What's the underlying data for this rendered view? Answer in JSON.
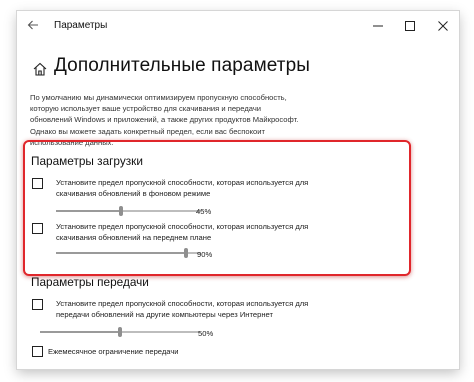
{
  "window": {
    "title": "Параметры"
  },
  "page": {
    "title": "Дополнительные параметры"
  },
  "description": "По умолчанию мы динамически оптимизируем пропускную способность, которую использует ваше устройство для скачивания и передачи обновлений Windows и приложений, а также других продуктов Майкрософт. Однако вы можете задать конкретный предел, если вас беспокоит использование данных.",
  "download": {
    "title": "Параметры загрузки",
    "options": [
      {
        "label": "Установите предел пропускной способности, которая используется для скачивания обновлений в фоновом режиме",
        "checked": false,
        "value_label": "45%",
        "value": 45
      },
      {
        "label": "Установите предел пропускной способности, которая используется для скачивания обновлений на переднем плане",
        "checked": false,
        "value_label": "90%",
        "value": 90
      }
    ]
  },
  "upload": {
    "title": "Параметры передачи",
    "options": [
      {
        "label": "Установите предел пропускной способности, которая используется для передачи обновлений на другие компьютеры через Интернет",
        "checked": false,
        "value_label": "50%",
        "value": 50
      },
      {
        "label": "Ежемесячное ограничение передачи",
        "checked": false
      }
    ]
  },
  "colors": {
    "highlight": "#e0262b",
    "slider_track": "#bdbdbd",
    "slider_thumb": "#8f8f8f"
  },
  "icons": {
    "back": "back-arrow-icon",
    "home": "home-icon",
    "minimize": "minimize-icon",
    "maximize": "maximize-icon",
    "close": "close-icon"
  }
}
